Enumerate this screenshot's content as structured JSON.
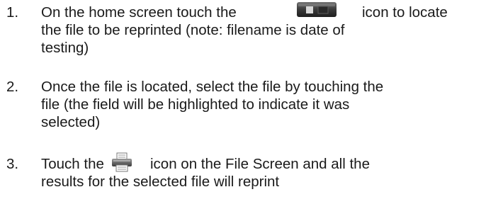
{
  "steps": [
    {
      "number": "1.",
      "lines": [
        {
          "before": "On the home screen touch the",
          "after": "icon to locate"
        },
        {
          "text": "the file to be reprinted (note: filename is date of"
        },
        {
          "text": "testing)"
        }
      ],
      "icon": "battery-file-icon"
    },
    {
      "number": "2.",
      "lines": [
        {
          "text": "Once the file is located, select the file by touching the"
        },
        {
          "text": "file (the field will be highlighted to indicate it was"
        },
        {
          "text": "selected)"
        }
      ]
    },
    {
      "number": "3.",
      "lines": [
        {
          "before": "Touch the",
          "after": "icon on the File Screen and all the"
        },
        {
          "text": "results for the selected file will reprint"
        }
      ],
      "icon": "printer-icon"
    }
  ]
}
